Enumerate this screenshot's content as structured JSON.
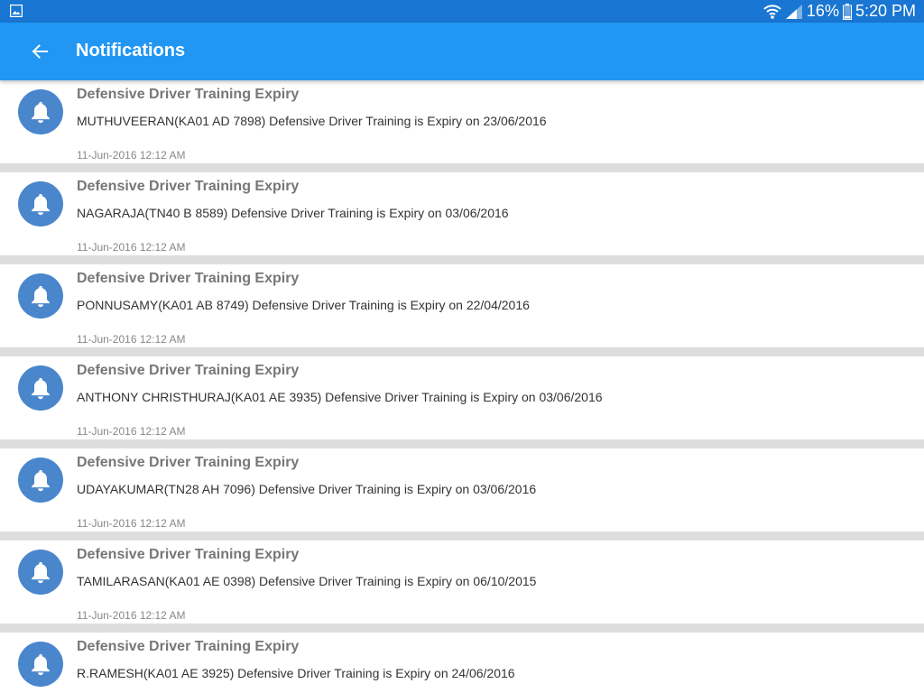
{
  "status_bar": {
    "battery": "16%",
    "time": "5:20 PM",
    "icons": [
      "gallery-icon",
      "wifi-icon",
      "signal-icon",
      "battery-icon"
    ]
  },
  "app_bar": {
    "title": "Notifications",
    "back_icon": "back-arrow-icon"
  },
  "colors": {
    "status_bar": "#1976D2",
    "app_bar": "#2196F3",
    "bell_circle": "#4A86CC",
    "divider": "#DDDDDD"
  },
  "notifications": [
    {
      "title": "Defensive Driver Training Expiry",
      "body": "MUTHUVEERAN(KA01 AD 7898) Defensive Driver Training is Expiry on 23/06/2016",
      "time": "11-Jun-2016 12:12 AM"
    },
    {
      "title": "Defensive Driver Training Expiry",
      "body": "NAGARAJA(TN40 B 8589) Defensive Driver Training is Expiry on 03/06/2016",
      "time": "11-Jun-2016 12:12 AM"
    },
    {
      "title": "Defensive Driver Training Expiry",
      "body": "PONNUSAMY(KA01 AB 8749) Defensive Driver Training is Expiry on 22/04/2016",
      "time": "11-Jun-2016 12:12 AM"
    },
    {
      "title": "Defensive Driver Training Expiry",
      "body": "ANTHONY CHRISTHURAJ(KA01 AE 3935) Defensive Driver Training is Expiry on 03/06/2016",
      "time": "11-Jun-2016 12:12 AM"
    },
    {
      "title": "Defensive Driver Training Expiry",
      "body": "UDAYAKUMAR(TN28 AH 7096) Defensive Driver Training is Expiry on 03/06/2016",
      "time": "11-Jun-2016 12:12 AM"
    },
    {
      "title": "Defensive Driver Training Expiry",
      "body": "TAMILARASAN(KA01 AE 0398) Defensive Driver Training is Expiry on 06/10/2015",
      "time": "11-Jun-2016 12:12 AM"
    },
    {
      "title": "Defensive Driver Training Expiry",
      "body": "R.RAMESH(KA01 AE 3925) Defensive Driver Training is Expiry on 24/06/2016",
      "time": ""
    }
  ]
}
